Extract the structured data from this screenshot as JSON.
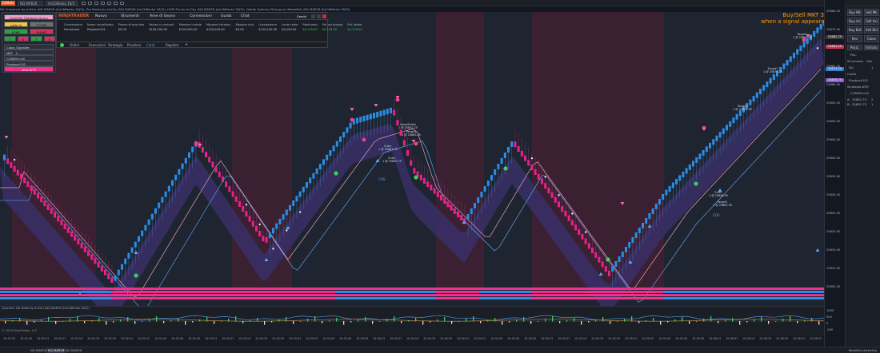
{
  "topbar": {
    "logo": "GoBots",
    "ticker": "NQ MAR26",
    "interval": "tmCbRenko 18/3",
    "tool_icons": [
      "cursor-icon",
      "crosshair-icon",
      "zoom-icon",
      "draw-icon",
      "text-icon",
      "magnet-icon",
      "settings-icon"
    ]
  },
  "indicator_line": "NA Crossover by tmCbu (NQ MAR26 (tmCbRenko 18/3)), Pro Renko by tmCbu (NQ MAR26 (tmCbRenko 18/3)), HOM Pro by tmCbu (NQ MAR26 (tmCbRenko 18/3)), Goblin Optimus Strong by tfdeadfish (NQ MAR26 (tmCbRenko 18/3))",
  "left_panel": {
    "title": "Liquidity OptiAlgo Strong",
    "buttons": [
      {
        "label": "Lotto in",
        "color": "#f5c542"
      },
      {
        "label": "ECORE",
        "color": "#6e6e6e"
      },
      {
        "label": "LONG",
        "color": "#2f9e44"
      },
      {
        "label": "SHORT",
        "color": "#d1365b"
      },
      {
        "label": "T",
        "color": "#2f9e44"
      },
      {
        "label": "X",
        "color": "#d1365b"
      },
      {
        "label": "T",
        "color": "#2f9e44"
      },
      {
        "label": "X",
        "color": "#d1365b"
      }
    ],
    "rows": [
      {
        "label": "Close_Signaller",
        "value": ""
      },
      {
        "label": "MKT",
        "value": "2"
      },
      {
        "label": "COSMIK mili",
        "value": ""
      },
      {
        "label": "Playback101",
        "value": ""
      }
    ],
    "bottom_button": "shut-in73"
  },
  "nt_window": {
    "brand": "NINJATRADER",
    "menu": [
      "Nuovo",
      "Strumenti",
      "Aree di lavoro",
      "Connessioni",
      "Guida",
      "Chat"
    ],
    "window_label": "Cerchi",
    "table": {
      "headers": [
        "Connessione",
        "Nome visualizzato",
        "Prezzo di acquisto",
        "Valore in contanti",
        "Margine iniziale",
        "Margine intraday",
        "Margine inizi",
        "Liquidazione",
        "Lorde reale",
        "Realizzato",
        "PnL ad origine",
        "PnL totale"
      ],
      "row": [
        "Formulrem",
        "Playback101",
        "$0.00",
        "$100,100.00",
        "$100,000.00",
        "$100,000.00",
        "$0.00",
        "$100,100.00",
        "$0,100.00",
        "$4,116.00",
        "$4,116.00",
        "$4,116.00"
      ]
    },
    "tabs": [
      "Ordini",
      "Esecuzioni",
      "Strategie",
      "Posizioni",
      "Conti",
      "Registro"
    ],
    "active_tab": "Conti"
  },
  "signal_text": {
    "line1": "Buy/Sell MKT 3",
    "line2": "when a signal appears"
  },
  "price_axis": {
    "ticks": [
      "25880.00",
      "25875.00",
      "25870.00",
      "25865.00",
      "25860.00",
      "25855.00",
      "25850.00",
      "25845.00",
      "25840.00",
      "25835.00",
      "25830.00",
      "25825.00",
      "25820.00",
      "25815.00",
      "25810.00",
      "25805.00"
    ],
    "tags": [
      {
        "label": "25882.75",
        "color": "#3a3a3a"
      },
      {
        "label": "25881.25",
        "color": "#d6304f"
      },
      {
        "label": "25873.50",
        "color": "#2f7fd6"
      },
      {
        "label": "25870.75",
        "color": "#8f5ad8"
      }
    ],
    "sub_ticks": [
      "1000",
      "500",
      "0",
      "-500"
    ]
  },
  "right_panel": {
    "buttons": [
      [
        "Buy Mk",
        "Sell Mk"
      ],
      [
        "Buy Asi",
        "Sell Asi"
      ],
      [
        "Buy Bid",
        "Sell Bid"
      ],
      [
        "Rev",
        "Close"
      ]
    ],
    "tabs": [
      "Posiz.",
      "Estrato"
    ],
    "pos_label": "Pos.",
    "strumento_label": "Strumento",
    "strumento_value": "NQ",
    "qty_label": "Qtd",
    "qty_value": "1",
    "conto_label": "Conto",
    "conto_value": "Playback101",
    "strategy_label": "Strategia ATM",
    "strategy_value": "COSMIK mili",
    "a_label": "A:",
    "a_value": "25882.75",
    "b_label": "B:",
    "b_value": "25881.75",
    "b_qty": "1",
    "a_qty": "2"
  },
  "annotations": [
    {
      "text": "Target1",
      "sub": "1 @ 25880.00"
    },
    {
      "text": "Target1",
      "sub": "1 @ 25870.25"
    },
    {
      "text": "Target1",
      "sub": "1 @ 25854.00"
    },
    {
      "text": "Stop/Shield",
      "sub": "1 @ 25852.75"
    },
    {
      "text": "Target1",
      "sub": "1 @ 25863.25"
    },
    {
      "text": "Entry",
      "sub": "1 @ 25847.25"
    },
    {
      "text": "Entry",
      "sub": "1 @ 25840.75"
    },
    {
      "text": "Entry",
      "sub": "1 @ 25846.00"
    }
  ],
  "cos_labels": [
    "COS",
    "COS"
  ],
  "subpanel_title": "Quantum Vol-Delta by tmCbu (NQ MAR26 (tmCbRenko 18/3))",
  "copyright": "© 2025 NinjaTrader, LLC",
  "time_ticks": [
    "15:31:52",
    "15:31:55",
    "15:32:01",
    "15:32:07",
    "15:32:13",
    "15:32:19",
    "15:32:25",
    "15:32:31",
    "15:32:37",
    "15:32:43",
    "15:32:49",
    "15:32:55",
    "15:33:01",
    "15:33:07",
    "15:33:13",
    "15:33:19",
    "15:33:25",
    "15:33:31",
    "15:33:37",
    "15:33:43",
    "15:33:49",
    "15:33:55",
    "15:34:01",
    "15:34:07",
    "15:34:13",
    "15:34:19",
    "15:34:25",
    "15:34:31",
    "15:34:37",
    "15:34:43",
    "15:34:49",
    "15:34:55",
    "15:35:01",
    "15:35:07",
    "15:35:13",
    "15:35:19",
    "15:35:25",
    "15:35:31",
    "15:35:37",
    "15:35:43",
    "15:35:49",
    "15:35:55",
    "15:36:01",
    "15:36:07",
    "15:36:13",
    "15:36:19",
    "15:36:25",
    "15:36:31",
    "15:36:37"
  ],
  "bottom_tabs": [
    "NQ MAR26",
    "NQ MAR26",
    "NQ MAR26"
  ],
  "active_bottom_tab": 1,
  "bottom_right": "Modalita dark/chip",
  "colors": {
    "bull": "#2a8ee8",
    "bear": "#f0208a",
    "bull_zone": "#1e2430",
    "bear_zone": "#3a2030",
    "band": "#3a2f6a"
  }
}
